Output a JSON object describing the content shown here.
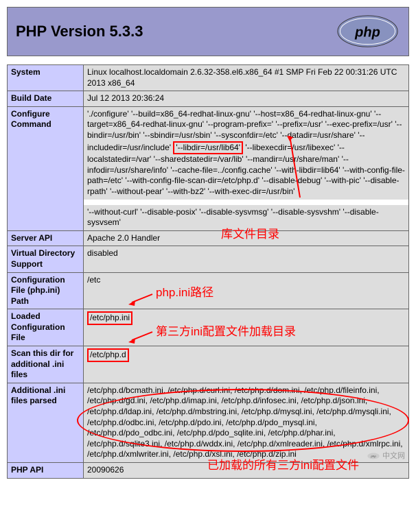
{
  "header": {
    "title": "PHP Version 5.3.3"
  },
  "rows": {
    "system": {
      "label": "System",
      "value": "Linux localhost.localdomain 2.6.32-358.el6.x86_64 #1 SMP Fri Feb 22 00:31:26 UTC 2013 x86_64"
    },
    "build_date": {
      "label": "Build Date",
      "value": "Jul 12 2013 20:36:24"
    },
    "configure": {
      "label": "Configure Command",
      "value_pre": "'./configure' '--build=x86_64-redhat-linux-gnu' '--host=x86_64-redhat-linux-gnu' '--target=x86_64-redhat-linux-gnu' '--program-prefix=' '--prefix=/usr' '--exec-prefix=/usr' '--bindir=/usr/bin' '--sbindir=/usr/sbin' '--sysconfdir=/etc' '--datadir=/usr/share' '--includedir=/usr/include' ",
      "value_highlight": "'--libdir=/usr/lib64'",
      "value_mid": " '--libexecdir=/usr/libexec' '--localstatedir=/var' '--sharedstatedir=/var/lib' '--mandir=/usr/share/man' '--infodir=/usr/share/info' '--cache-file=../config.cache' '--with-libdir=lib64' '--with-config-file-path=/etc' '--with-config-file-scan-dir=/etc/php.d' '--disable-debug' '--with-pic' '--disable-rpath' '--without-pear' '--with-bz2' '--with-exec-dir=/usr/bin'",
      "value_after_gap": "'--without-curl' '--disable-posix' '--disable-sysvmsg' '--disable-sysvshm' '--disable-sysvsem'"
    },
    "server_api": {
      "label": "Server API",
      "value": "Apache 2.0 Handler"
    },
    "vds": {
      "label": "Virtual Directory Support",
      "value": "disabled"
    },
    "config_path": {
      "label": "Configuration File (php.ini) Path",
      "value": "/etc"
    },
    "loaded_config": {
      "label": "Loaded Configuration File",
      "value": "/etc/php.ini"
    },
    "scan_dir": {
      "label": "Scan this dir for additional .ini files",
      "value": "/etc/php.d"
    },
    "additional_ini": {
      "label": "Additional .ini files parsed",
      "value": "/etc/php.d/bcmath.ini, /etc/php.d/curl.ini, /etc/php.d/dom.ini, /etc/php.d/fileinfo.ini, /etc/php.d/gd.ini, /etc/php.d/imap.ini, /etc/php.d/infosec.ini, /etc/php.d/json.ini, /etc/php.d/ldap.ini, /etc/php.d/mbstring.ini, /etc/php.d/mysql.ini, /etc/php.d/mysqli.ini, /etc/php.d/odbc.ini, /etc/php.d/pdo.ini, /etc/php.d/pdo_mysql.ini, /etc/php.d/pdo_odbc.ini, /etc/php.d/pdo_sqlite.ini, /etc/php.d/phar.ini, /etc/php.d/sqlite3.ini, /etc/php.d/wddx.ini, /etc/php.d/xmlreader.ini, /etc/php.d/xmlrpc.ini, /etc/php.d/xmlwriter.ini, /etc/php.d/xsl.ini, /etc/php.d/zip.ini"
    },
    "php_api": {
      "label": "PHP API",
      "value": "20090626"
    }
  },
  "annotations": {
    "libdir": "库文件目录",
    "phpini": "php.ini路径",
    "third_party": "第三方ini配置文件加载目录",
    "loaded_all": "已加载的所有三方ini配置文件"
  },
  "watermark": "中文网"
}
